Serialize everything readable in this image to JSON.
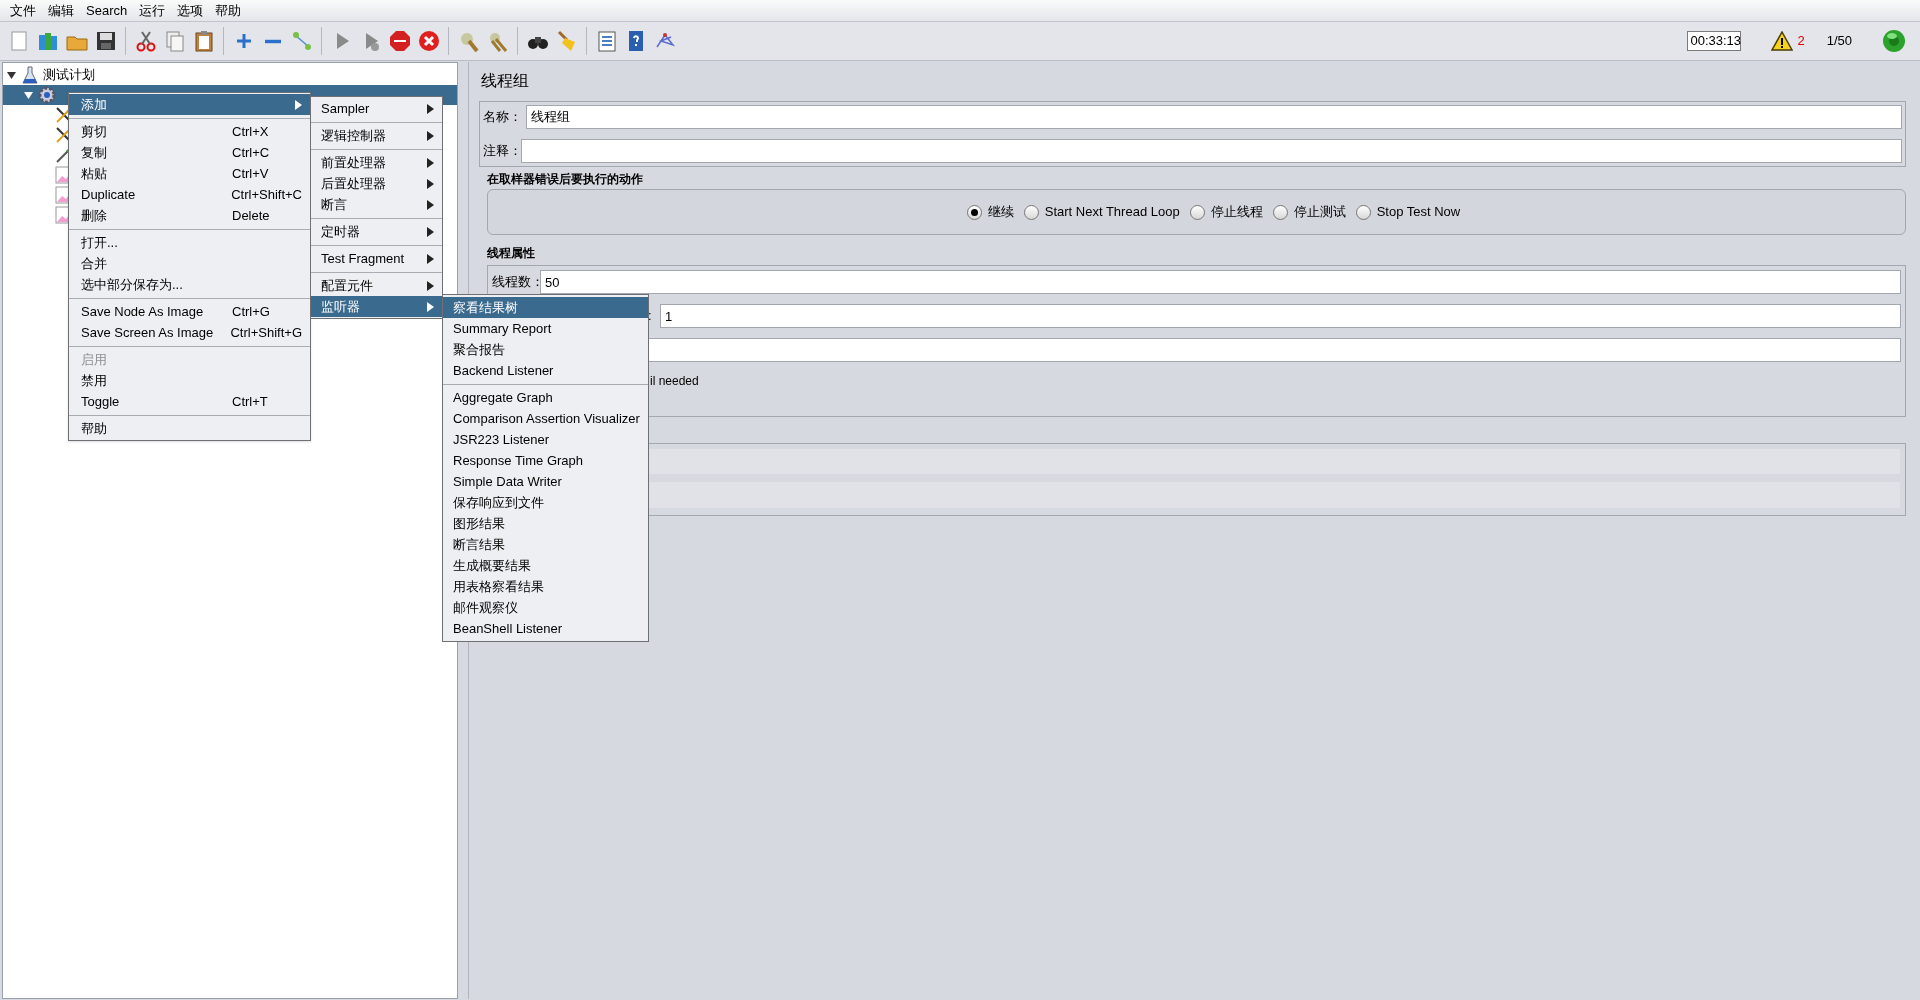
{
  "menu_bar": [
    {
      "label": "文件"
    },
    {
      "label": "编辑"
    },
    {
      "label": "Search"
    },
    {
      "label": "运行"
    },
    {
      "label": "选项"
    },
    {
      "label": "帮助"
    }
  ],
  "status": {
    "timer": "00:33:13",
    "warnings": "2",
    "threads": "1/50"
  },
  "tree": [
    {
      "label": "测试计划",
      "kind": "plan",
      "expanded": true,
      "selected": false,
      "children": [
        {
          "kind": "group",
          "expanded": true,
          "selected": true,
          "children": [
            {
              "kind": "tools",
              "selected": false
            },
            {
              "kind": "tools",
              "selected": false
            },
            {
              "kind": "pen",
              "selected": false
            },
            {
              "kind": "graph",
              "selected": false
            },
            {
              "kind": "graph",
              "selected": false
            },
            {
              "kind": "graph",
              "selected": false
            }
          ]
        }
      ]
    }
  ],
  "context_menu": [
    [
      {
        "label": "添加",
        "submenu": true,
        "disabled": false,
        "selected": true
      }
    ],
    [
      {
        "label": "剪切",
        "shortcut": "Ctrl+X",
        "submenu": false,
        "disabled": false,
        "selected": false
      },
      {
        "label": "复制",
        "shortcut": "Ctrl+C",
        "submenu": false,
        "disabled": false,
        "selected": false
      },
      {
        "label": "粘贴",
        "shortcut": "Ctrl+V",
        "submenu": false,
        "disabled": false,
        "selected": false
      },
      {
        "label": "Duplicate",
        "shortcut": "Ctrl+Shift+C",
        "submenu": false,
        "disabled": false,
        "selected": false
      },
      {
        "label": "删除",
        "shortcut": "Delete",
        "submenu": false,
        "disabled": false,
        "selected": false
      }
    ],
    [
      {
        "label": "打开...",
        "submenu": false,
        "disabled": false,
        "selected": false
      },
      {
        "label": "合并",
        "submenu": false,
        "disabled": false,
        "selected": false
      },
      {
        "label": "选中部分保存为...",
        "submenu": false,
        "disabled": false,
        "selected": false
      }
    ],
    [
      {
        "label": "Save Node As Image",
        "shortcut": "Ctrl+G",
        "submenu": false,
        "disabled": false,
        "selected": false
      },
      {
        "label": "Save Screen As Image",
        "shortcut": "Ctrl+Shift+G",
        "submenu": false,
        "disabled": false,
        "selected": false
      }
    ],
    [
      {
        "label": "启用",
        "submenu": false,
        "disabled": true,
        "selected": false
      },
      {
        "label": "禁用",
        "submenu": false,
        "disabled": false,
        "selected": false
      },
      {
        "label": "Toggle",
        "shortcut": "Ctrl+T",
        "submenu": false,
        "disabled": false,
        "selected": false
      }
    ],
    [
      {
        "label": "帮助",
        "submenu": false,
        "disabled": false,
        "selected": false
      }
    ]
  ],
  "add_submenu": [
    [
      {
        "label": "Sampler",
        "selected": false
      }
    ],
    [
      {
        "label": "逻辑控制器",
        "selected": false
      }
    ],
    [
      {
        "label": "前置处理器",
        "selected": false
      },
      {
        "label": "后置处理器",
        "selected": false
      },
      {
        "label": "断言",
        "selected": false
      }
    ],
    [
      {
        "label": "定时器",
        "selected": false
      }
    ],
    [
      {
        "label": "Test Fragment",
        "selected": false
      }
    ],
    [
      {
        "label": "配置元件",
        "selected": false
      },
      {
        "label": "监听器",
        "selected": true
      }
    ]
  ],
  "listener_submenu": [
    [
      {
        "label": "察看结果树",
        "selected": true
      },
      {
        "label": "Summary Report",
        "selected": false
      },
      {
        "label": "聚合报告",
        "selected": false
      },
      {
        "label": "Backend Listener",
        "selected": false
      }
    ],
    [
      {
        "label": "Aggregate Graph",
        "selected": false
      },
      {
        "label": "Comparison Assertion Visualizer",
        "selected": false
      },
      {
        "label": "JSR223 Listener",
        "selected": false
      },
      {
        "label": "Response Time Graph",
        "selected": false
      },
      {
        "label": "Simple Data Writer",
        "selected": false
      },
      {
        "label": "保存响应到文件",
        "selected": false
      },
      {
        "label": "图形结果",
        "selected": false
      },
      {
        "label": "断言结果",
        "selected": false
      },
      {
        "label": "生成概要结果",
        "selected": false
      },
      {
        "label": "用表格察看结果",
        "selected": false
      },
      {
        "label": "邮件观察仪",
        "selected": false
      },
      {
        "label": "BeanShell Listener",
        "selected": false
      }
    ]
  ],
  "form": {
    "title": "线程组",
    "name_label": "名称：",
    "name_value": "线程组",
    "comment_label": "注释：",
    "error_action": {
      "title": "在取样器错误后要执行的动作",
      "options": [
        {
          "label": "继续",
          "selected": true
        },
        {
          "label": "Start Next Thread Loop",
          "selected": false
        },
        {
          "label": "停止线程",
          "selected": false
        },
        {
          "label": "停止测试",
          "selected": false
        },
        {
          "label": "Stop Test Now",
          "selected": false
        }
      ]
    },
    "thread_properties": {
      "title": "线程属性",
      "threads_label": "线程数：",
      "threads_value": "50",
      "ramp_label": ":",
      "ramp_value": "1",
      "loop_note": "il needed"
    }
  }
}
